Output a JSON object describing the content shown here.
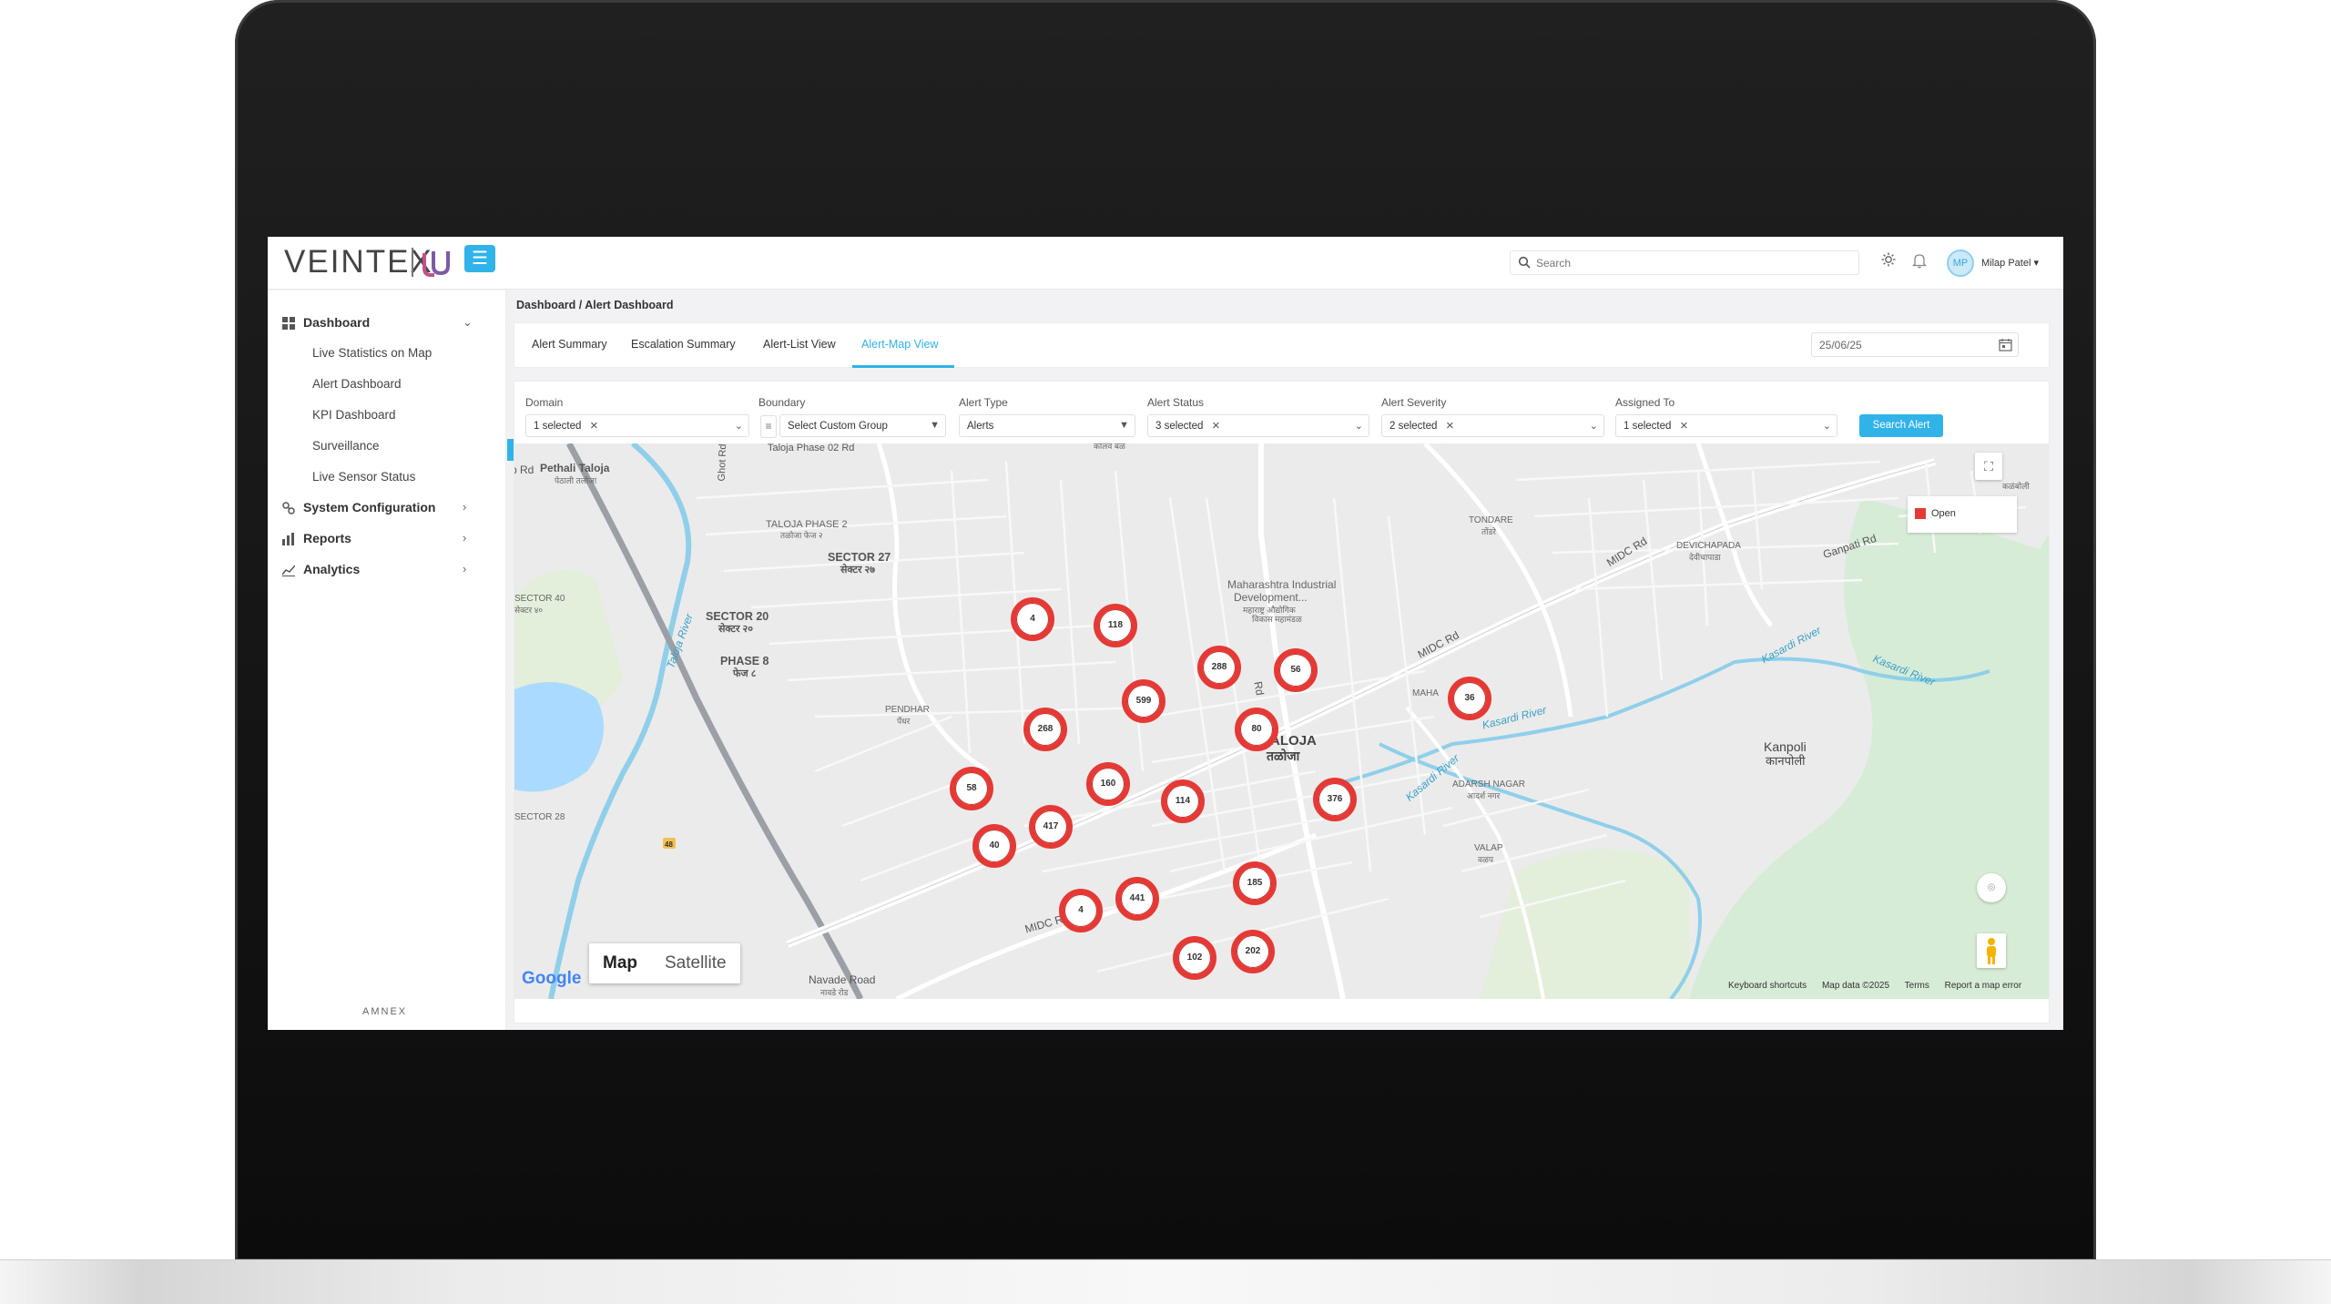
{
  "header": {
    "logo_text": "VEINTEX",
    "search_placeholder": "Search",
    "user_initials": "MP",
    "user_name": "Milap Patel"
  },
  "sidebar": {
    "items": [
      {
        "label": "Dashboard",
        "icon": "grid-icon"
      },
      {
        "label": "System Configuration",
        "icon": "config-icon"
      },
      {
        "label": "Reports",
        "icon": "bar-chart-icon"
      },
      {
        "label": "Analytics",
        "icon": "analytics-icon"
      }
    ],
    "dashboard_children": [
      "Live Statistics on Map",
      "Alert Dashboard",
      "KPI Dashboard",
      "Surveillance",
      "Live Sensor Status"
    ],
    "footer_brand": "AMNEX"
  },
  "breadcrumb": "Dashboard / Alert Dashboard",
  "tabs": [
    "Alert Summary",
    "Escalation Summary",
    "Alert-List View",
    "Alert-Map View"
  ],
  "active_tab": "Alert-Map View",
  "date_value": "25/06/25",
  "filters": {
    "domain": {
      "label": "Domain",
      "value": "1 selected"
    },
    "boundary": {
      "label": "Boundary",
      "value": "Select Custom Group"
    },
    "alert_type": {
      "label": "Alert Type",
      "value": "Alerts"
    },
    "alert_status": {
      "label": "Alert Status",
      "value": "3 selected"
    },
    "alert_severity": {
      "label": "Alert Severity",
      "value": "2 selected"
    },
    "assigned_to": {
      "label": "Assigned To",
      "value": "1 selected"
    },
    "search_button": "Search Alert"
  },
  "map": {
    "legend": {
      "label": "Open",
      "color": "#e53935"
    },
    "map_type": [
      "Map",
      "Satellite"
    ],
    "google_logo": "Google",
    "attribution": [
      "Keyboard shortcuts",
      "Map data ©2025",
      "Terms",
      "Report a map error"
    ],
    "clusters": [
      "4",
      "118",
      "288",
      "56",
      "599",
      "268",
      "80",
      "36",
      "58",
      "160",
      "114",
      "376",
      "417",
      "40",
      "185",
      "4",
      "441",
      "102",
      "202"
    ],
    "labels": {
      "pethali_taloja": "Pethali Taloja",
      "pethali_taloja_mr": "पेठाली तलोजा",
      "taloja_phase_2": "TALOJA PHASE 2",
      "taloja_phase_2_mr": "तळोजा फेज २",
      "taloja_phase_02_rd": "Taloja Phase 02 Rd",
      "sector_27": "SECTOR 27",
      "sector_27_mr": "सेक्टर २७",
      "sector_20": "SECTOR 20",
      "sector_20_mr": "सेक्टर २०",
      "phase_8": "PHASE 8",
      "phase_8_mr": "फेज ८",
      "sector_40": "SECTOR 40",
      "sector_40_mr": "सेक्टर ४०",
      "sector_28": "SECTOR 28",
      "pendhar": "PENDHAR",
      "pendhar_mr": "पेंधर",
      "maharashtra_industrial": "Maharashtra Industrial",
      "development": "Development...",
      "development_mr": "महाराष्ट्र औद्योगिक",
      "development_mr2": "विकास महामंडळ",
      "taloja": "TALOJA",
      "taloja_mr": "तळोजा",
      "tondare": "TONDARE",
      "tondare_mr": "तोंडरे",
      "devichapada": "DEVICHAPADA",
      "devichapada_mr": "देवीचापाडा",
      "adarsh_nagar": "ADARSH NAGAR",
      "adarsh_nagar_mr": "आदर्श नगर",
      "valap": "VALAP",
      "valap_mr": "वळप",
      "kanpoli": "Kanpoli",
      "kanpoli_mr": "कानपोली",
      "maha": "MAHA",
      "midc_rd_1": "MIDC Rd",
      "midc_rd_2": "MIDC Rd",
      "midc_rd_3": "MIDC Rd",
      "ganpati_rd": "Ganpati Rd",
      "navade_road": "Navade Road",
      "navade_road_mr": "नावडे रोड",
      "taloja_river": "Taloja River",
      "kasardi_river_1": "Kasardi River",
      "kasardi_river_2": "Kasardi River",
      "kasardi_river_3": "Kasardi River",
      "kasardi_river_4": "Kasardi River",
      "rd": "Rd",
      "ghot_rd": "Ghot Rd",
      "p_rd": "p Rd",
      "top_partial": "कोलवे बळ",
      "right_partial": "कळंबोली",
      "route_48": "48"
    }
  }
}
